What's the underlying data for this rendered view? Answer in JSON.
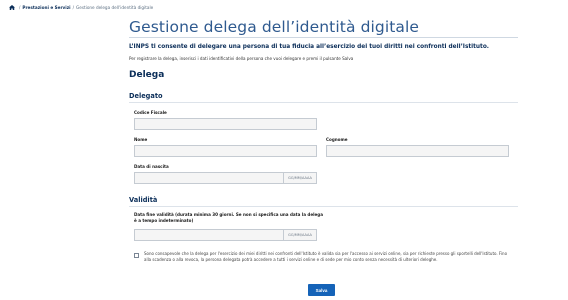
{
  "breadcrumb": {
    "home_icon": "home-icon",
    "separator": "/",
    "items": [
      "Prestazioni e Servizi",
      "Gestione delega dell'identità digitale"
    ]
  },
  "page": {
    "title": "Gestione delega dell’identità digitale",
    "intro": "L’INPS ti consente di delegare una persona di tua fiducia all’esercizio dei tuoi diritti nei confronti dell’Istituto.",
    "hint": "Per registrare la delega, inserisci i dati identificativi della persona che vuoi delegare e premi il pulsante Salva"
  },
  "form": {
    "heading": "Delega",
    "delegato": {
      "heading": "Delegato",
      "codice_fiscale_label": "Codice Fiscale",
      "nome_label": "Nome",
      "cognome_label": "Cognome",
      "data_nascita_label": "Data di nascita",
      "date_placeholder": "GG/MM/AAAA"
    },
    "validita": {
      "heading": "Validità",
      "data_fine_label": "Data fine validità (durata minima 30 giorni. Se non si specifica una data la delega è a tempo indeterminato)",
      "date_placeholder": "GG/MM/AAAA"
    },
    "consent_text": "Sono consapevole che la delega per l'esercizio dei miei diritti nei confronti dell'Istituto è valida sia per l'accesso ai servizi online, sia per richieste presso gli sportelli dell'Istituto. Fino alla scadenza o alla revoca, la persona delegata potrà accedere a tutti i servizi online e di sede per mio conto senza necessità di ulteriori deleghe.",
    "save_label": "Salva"
  },
  "colors": {
    "title": "#2f5a8f",
    "heading": "#0b2e59",
    "primary_button": "#1563b8"
  }
}
